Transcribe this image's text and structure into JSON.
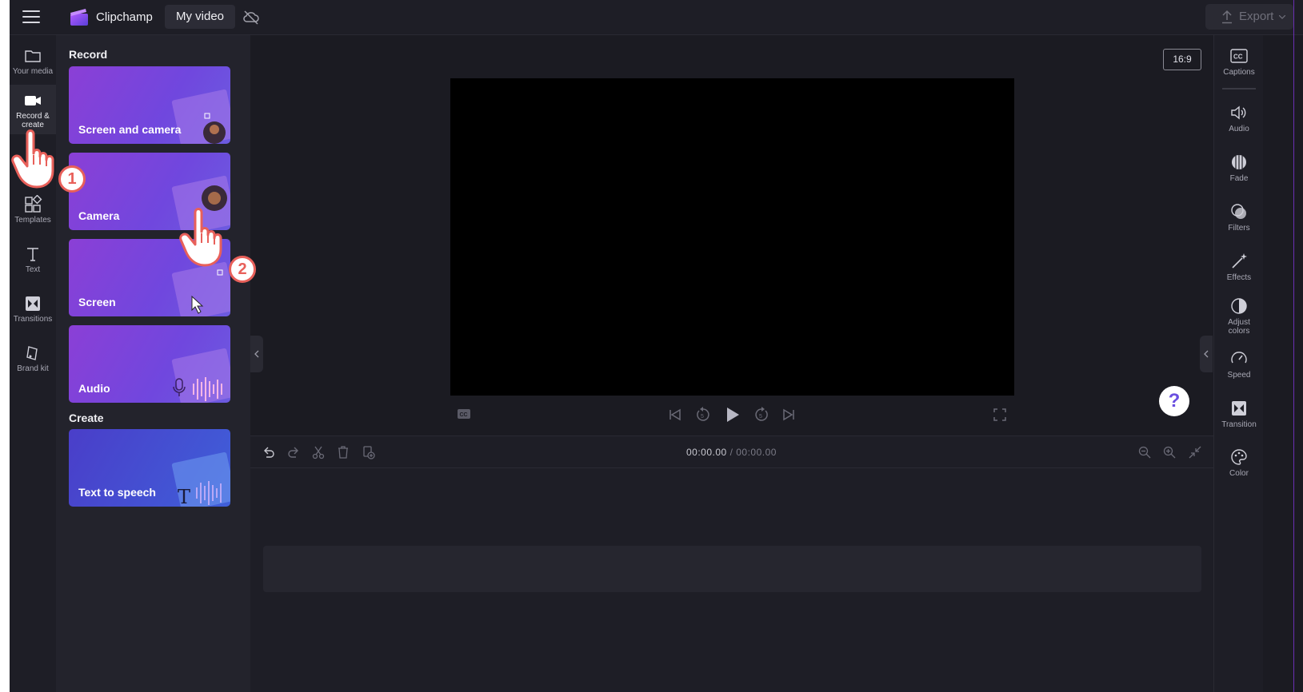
{
  "topbar": {
    "app_name": "Clipchamp",
    "project_title": "My video",
    "export_label": "Export"
  },
  "left_rail": {
    "items": [
      {
        "label": "Your media",
        "icon": "folder-icon"
      },
      {
        "label": "Record & create",
        "icon": "video-camera-icon"
      },
      {
        "label": "Templates",
        "icon": "templates-icon"
      },
      {
        "label": "Text",
        "icon": "text-icon"
      },
      {
        "label": "Transitions",
        "icon": "transitions-icon"
      },
      {
        "label": "Brand kit",
        "icon": "brand-kit-icon"
      }
    ]
  },
  "panel": {
    "record_title": "Record",
    "create_title": "Create",
    "cards": [
      {
        "label": "Screen and camera"
      },
      {
        "label": "Camera"
      },
      {
        "label": "Screen"
      },
      {
        "label": "Audio"
      }
    ],
    "create_cards": [
      {
        "label": "Text to speech"
      }
    ]
  },
  "preview": {
    "aspect_ratio": "16:9",
    "help_label": "?"
  },
  "timeline": {
    "current_time": "00:00.00",
    "separator": "/",
    "total_time": "00:00.00"
  },
  "right_rail": {
    "items": [
      {
        "label": "Captions",
        "icon": "captions-icon"
      },
      {
        "label": "Audio",
        "icon": "speaker-icon"
      },
      {
        "label": "Fade",
        "icon": "fade-icon"
      },
      {
        "label": "Filters",
        "icon": "filters-icon"
      },
      {
        "label": "Effects",
        "icon": "magic-wand-icon"
      },
      {
        "label": "Adjust colors",
        "icon": "contrast-icon"
      },
      {
        "label": "Speed",
        "icon": "speedometer-icon"
      },
      {
        "label": "Transition",
        "icon": "transition-icon"
      },
      {
        "label": "Color",
        "icon": "palette-icon"
      }
    ]
  },
  "annotations": {
    "step1": "1",
    "step2": "2"
  },
  "colors": {
    "accent": "#7047de",
    "marker": "#e8605a",
    "background": "#1b1b22"
  }
}
